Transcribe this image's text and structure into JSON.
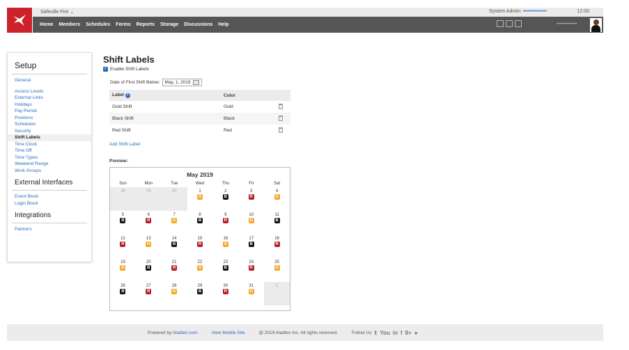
{
  "header": {
    "org": "Safeville Fire",
    "sys_label": "System Admin:",
    "user_masked": "••••••••••••••",
    "time": "12:00",
    "user_right": "••••••••••••••"
  },
  "nav": [
    "Home",
    "Members",
    "Schedules",
    "Forms",
    "Reports",
    "Storage",
    "Discussions",
    "Help"
  ],
  "sidebar": {
    "setup_title": "Setup",
    "general": "General",
    "items": [
      "Access Levels",
      "External Links",
      "Holidays",
      "Pay Period",
      "Positions",
      "Schedules",
      "Security",
      "Shift Labels",
      "Time Clock",
      "Time Off",
      "Time Types",
      "Weekend Range",
      "Work Groups"
    ],
    "ext_title": "External Interfaces",
    "ext_items": [
      "Event Block",
      "Login Block"
    ],
    "int_title": "Integrations",
    "int_items": [
      "Partners"
    ]
  },
  "main": {
    "title": "Shift Labels",
    "enable_label": "Enable Shift Labels",
    "date_label": "Date of First Shift Below:",
    "date_value": "May, 1, 2019",
    "col_label": "Label",
    "col_color": "Color",
    "rows": [
      {
        "label": "Gold Shift",
        "color": "Gold"
      },
      {
        "label": "Black Shift",
        "color": "Black"
      },
      {
        "label": "Red Shift",
        "color": "Red"
      }
    ],
    "add_link": "Add Shift Label",
    "preview_label": "Preview:"
  },
  "calendar": {
    "title": "May 2019",
    "days": [
      "Sun",
      "Mon",
      "Tue",
      "Wed",
      "Thu",
      "Fri",
      "Sat"
    ],
    "cells": [
      {
        "d": "28",
        "out": true,
        "s": ""
      },
      {
        "d": "29",
        "out": true,
        "s": ""
      },
      {
        "d": "30",
        "out": true,
        "s": ""
      },
      {
        "d": "1",
        "s": "G"
      },
      {
        "d": "2",
        "s": "B"
      },
      {
        "d": "3",
        "s": "R"
      },
      {
        "d": "4",
        "s": "G"
      },
      {
        "d": "5",
        "s": "B"
      },
      {
        "d": "6",
        "s": "R"
      },
      {
        "d": "7",
        "s": "G"
      },
      {
        "d": "8",
        "s": "B"
      },
      {
        "d": "9",
        "s": "R"
      },
      {
        "d": "10",
        "s": "G"
      },
      {
        "d": "11",
        "s": "B"
      },
      {
        "d": "12",
        "s": "R"
      },
      {
        "d": "13",
        "s": "G"
      },
      {
        "d": "14",
        "s": "B"
      },
      {
        "d": "15",
        "s": "R"
      },
      {
        "d": "16",
        "s": "G"
      },
      {
        "d": "17",
        "s": "B"
      },
      {
        "d": "18",
        "s": "R"
      },
      {
        "d": "19",
        "s": "G"
      },
      {
        "d": "20",
        "s": "B"
      },
      {
        "d": "21",
        "s": "R"
      },
      {
        "d": "22",
        "s": "G"
      },
      {
        "d": "23",
        "s": "B"
      },
      {
        "d": "24",
        "s": "R"
      },
      {
        "d": "25",
        "s": "G"
      },
      {
        "d": "26",
        "s": "B"
      },
      {
        "d": "27",
        "s": "R"
      },
      {
        "d": "28",
        "s": "G"
      },
      {
        "d": "29",
        "s": "B"
      },
      {
        "d": "30",
        "s": "R"
      },
      {
        "d": "31",
        "s": "G"
      },
      {
        "d": "1",
        "out": true,
        "s": ""
      }
    ]
  },
  "footer": {
    "powered": "Powered by",
    "aladtec": "Aladtec.com",
    "mobile": "View Mobile Site",
    "copyright": "@ 2019 Aladtec Inc. All rights reserved.",
    "follow": "Follow Us",
    "social": [
      "𝕥",
      "You",
      "in",
      "f",
      "8+",
      "●"
    ]
  }
}
